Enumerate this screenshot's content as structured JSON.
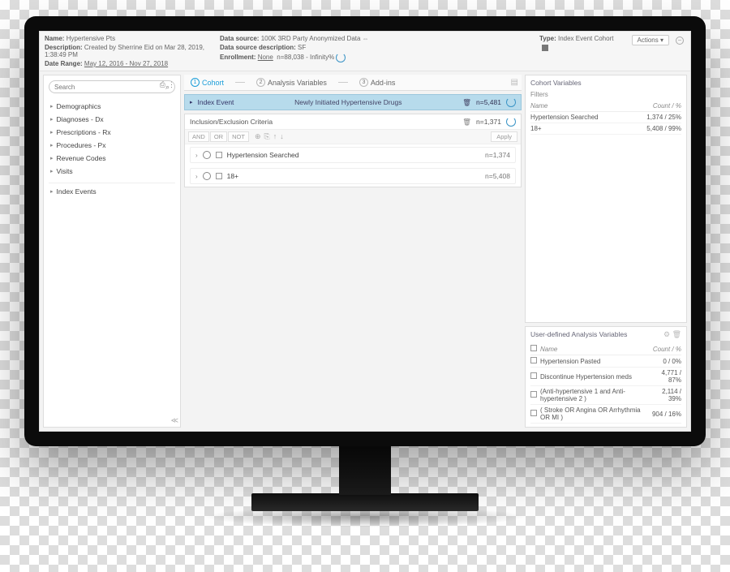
{
  "meta": {
    "name_lbl": "Name:",
    "name": "Hypertensive Pts",
    "desc_lbl": "Description:",
    "desc": "Created by Sherrine Eid on Mar 28, 2019, 1:38:49 PM",
    "range_lbl": "Date Range:",
    "range": "May 12, 2016 - Nov 27, 2018",
    "ds_lbl": "Data source:",
    "ds": "100K 3RD Party Anonymized Data",
    "dsd_lbl": "Data source description:",
    "dsd": "SF",
    "enroll_lbl": "Enrollment:",
    "enroll": "None",
    "enroll_range": "n=88,038 - Infinity%",
    "type_lbl": "Type:",
    "type": "Index Event Cohort",
    "actions": "Actions ▾"
  },
  "sidebar": {
    "search_ph": "Search",
    "items": [
      "Demographics",
      "Diagnoses - Dx",
      "Prescriptions - Rx",
      "Procedures - Px",
      "Revenue Codes",
      "Visits"
    ],
    "index_events": "Index Events"
  },
  "tabs": {
    "t1": "Cohort",
    "t2": "Analysis Variables",
    "t3": "Add-ins"
  },
  "index_bar": {
    "title": "Index Event",
    "center": "Newly Initiated Hypertensive Drugs",
    "count": "n=5,481"
  },
  "criteria": {
    "title": "Inclusion/Exclusion Criteria",
    "count": "n=1,371",
    "and": "AND",
    "or": "OR",
    "not": "NOT",
    "apply": "Apply",
    "rows": [
      {
        "label": "Hypertension Searched",
        "count": "n=1,374"
      },
      {
        "label": "18+",
        "count": "n=5,408"
      }
    ]
  },
  "cohort_vars": {
    "title": "Cohort Variables",
    "filters": "Filters",
    "h_name": "Name",
    "h_count": "Count / %",
    "rows": [
      {
        "name": "Hypertension Searched",
        "val": "1,374 / 25%"
      },
      {
        "name": "18+",
        "val": "5,408 / 99%"
      }
    ]
  },
  "udav": {
    "title": "User-defined Analysis Variables",
    "h_name": "Name",
    "h_count": "Count / %",
    "rows": [
      {
        "name": "Hypertension Pasted",
        "val": "0 / 0%"
      },
      {
        "name": "Discontinue Hypertension meds",
        "val": "4,771 / 87%"
      },
      {
        "name": "(Anti-hypertensive 1 and Anti-hypertensive 2 )",
        "val": "2,114 / 39%"
      },
      {
        "name": "( Stroke OR Angina OR Arrhythmia OR MI )",
        "val": "904 / 16%"
      }
    ]
  }
}
